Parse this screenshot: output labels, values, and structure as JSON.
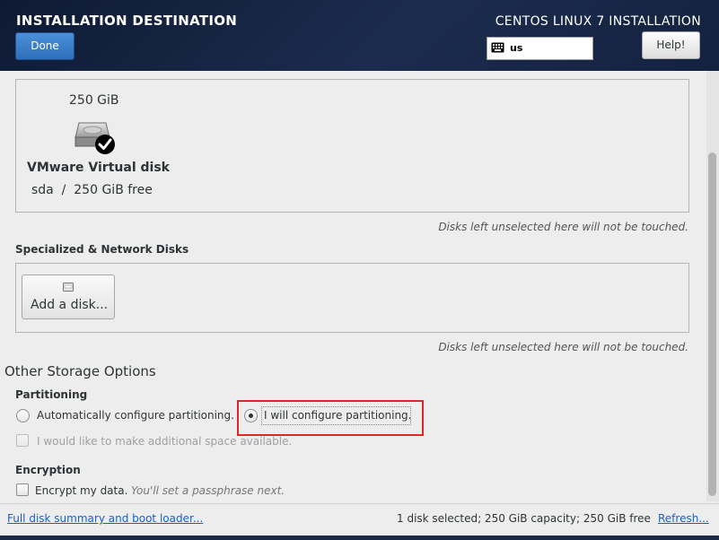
{
  "header": {
    "title": "INSTALLATION DESTINATION",
    "done_label": "Done",
    "product": "CENTOS LINUX 7 INSTALLATION",
    "keyboard_layout": "us",
    "help_label": "Help!"
  },
  "local_disk": {
    "size": "250 GiB",
    "name": "VMware Virtual disk",
    "device_free": "sda  /  250 GiB free"
  },
  "notes": {
    "unselected_local": "Disks left unselected here will not be touched.",
    "unselected_network": "Disks left unselected here will not be touched."
  },
  "specialized": {
    "title": "Specialized & Network Disks",
    "add_disk_label": "Add a disk..."
  },
  "other": {
    "title": "Other Storage Options",
    "partitioning_label": "Partitioning",
    "auto_label": "Automatically configure partitioning.",
    "custom_label": "I will configure partitioning.",
    "space_label": "I would like to make additional space available.",
    "encryption_label": "Encryption",
    "encrypt_label": "Encrypt my data.",
    "encrypt_hint": "You'll set a passphrase next."
  },
  "footer": {
    "summary_link": "Full disk summary and boot loader...",
    "status": "1 disk selected; 250 GiB capacity; 250 GiB free",
    "refresh_link": "Refresh..."
  },
  "colors": {
    "header_bg": "#1c2c4e",
    "done_blue": "#2f6fba",
    "link_blue": "#1c5fc4",
    "highlight_red": "#e02727"
  },
  "icons": {
    "keyboard": "keyboard-icon",
    "disk": "hard-disk-icon",
    "checkmark": "checkmark-icon",
    "add_disk": "disk-add-icon"
  }
}
